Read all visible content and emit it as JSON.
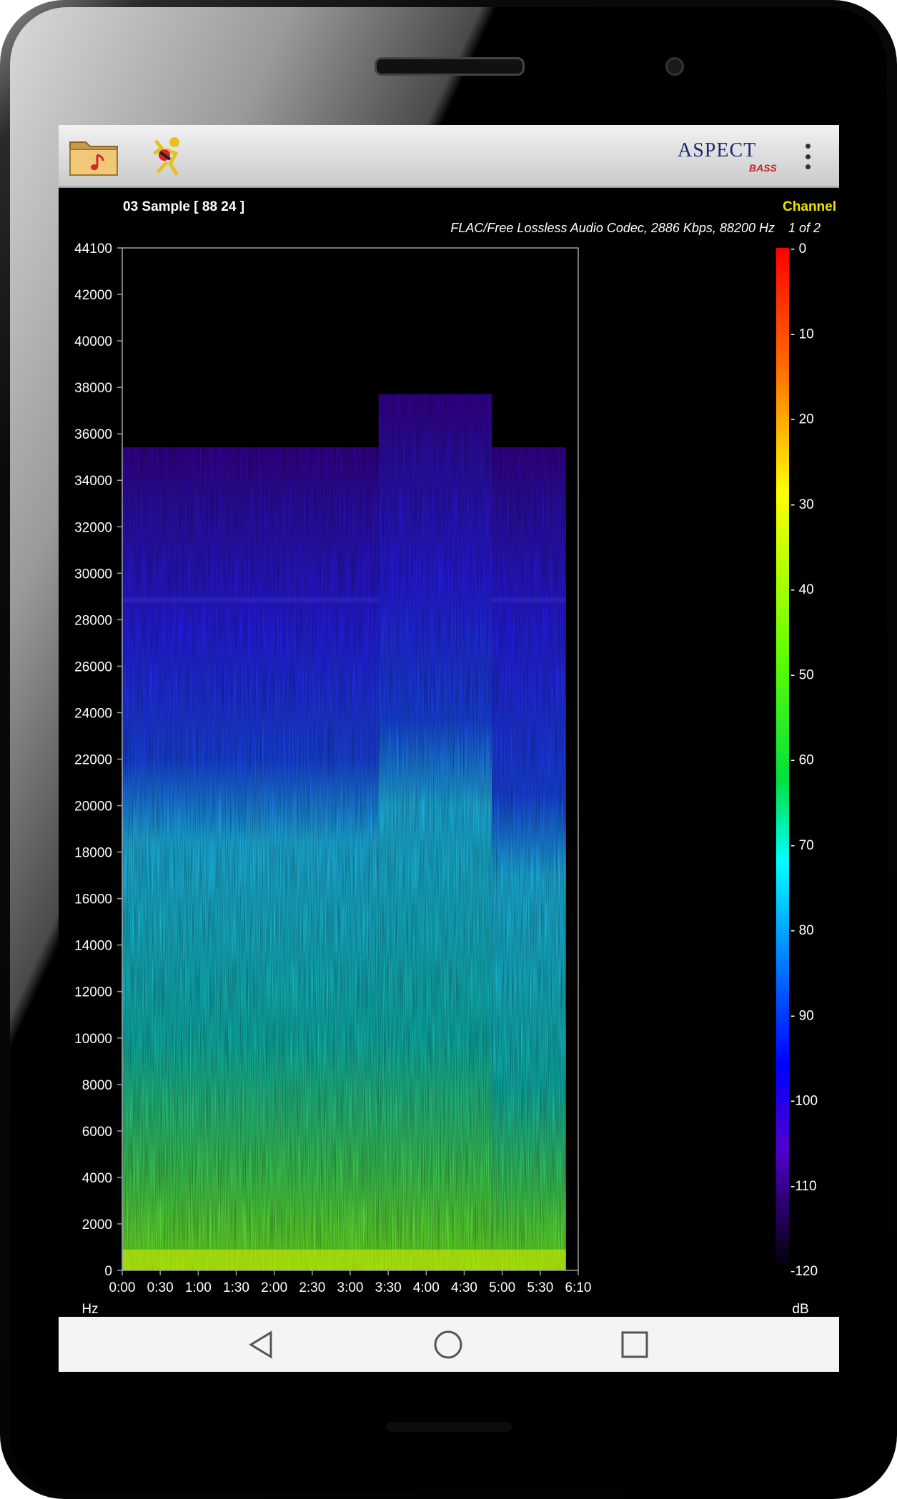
{
  "app": {
    "title_line": "03 Sample [ 88 24 ]",
    "codec_info": "FLAC/Free Lossless Audio Codec, 2886 Kbps, 88200 Hz",
    "channel_label": "Channel",
    "channel_value": "1 of 2",
    "logo_main": "ASPECT",
    "logo_sub": "BASS",
    "icons": {
      "open_file": "folder-music-icon",
      "tuner": "tuner-icon",
      "menu": "more-vert-icon",
      "back": "back-triangle-icon",
      "home": "home-circle-icon",
      "recents": "recents-square-icon"
    }
  },
  "chart_data": {
    "type": "heatmap",
    "xlabel": "",
    "ylabel": "Hz",
    "colorbar_label": "dB",
    "x_ticks": [
      "0:00",
      "0:30",
      "1:00",
      "1:30",
      "2:00",
      "2:30",
      "3:00",
      "3:30",
      "4:00",
      "4:30",
      "5:00",
      "5:30",
      "6:10"
    ],
    "y_ticks": [
      "44100",
      "42000",
      "40000",
      "38000",
      "36000",
      "34000",
      "32000",
      "30000",
      "28000",
      "26000",
      "24000",
      "22000",
      "20000",
      "18000",
      "16000",
      "14000",
      "12000",
      "10000",
      "8000",
      "6000",
      "4000",
      "2000",
      "0"
    ],
    "xlim_seconds": [
      0,
      370
    ],
    "ylim_hz": [
      0,
      44100
    ],
    "colorbar_ticks": [
      "- 0",
      "- 10",
      "- 20",
      "- 30",
      "- 40",
      "- 50",
      "- 60",
      "- 70",
      "- 80",
      "- 90",
      "-100",
      "-110",
      "-120"
    ],
    "colorbar_range_db": [
      -120,
      0
    ],
    "colors": {
      "colorbar_stops": [
        "#ff0000",
        "#ff8000",
        "#ffff00",
        "#00ff00",
        "#00ffff",
        "#0000ff",
        "#4000c0",
        "#000000"
      ],
      "spectrum_high": "#7cff20",
      "spectrum_mid": "#20c8ff",
      "spectrum_low": "#2a20ff",
      "spectrum_faint": "#3a00a0"
    },
    "segments": [
      {
        "start_s": 0,
        "end_s": 208,
        "cutoff_hz": 35500,
        "line_hz": 28900,
        "green_to_hz": 10000,
        "cyan_to_hz": 18500
      },
      {
        "start_s": 208,
        "end_s": 300,
        "cutoff_hz": 37800,
        "line_hz": null,
        "green_to_hz": 10000,
        "cyan_to_hz": 20000
      },
      {
        "start_s": 300,
        "end_s": 360,
        "cutoff_hz": 35500,
        "line_hz": 28900,
        "green_to_hz": 8000,
        "cyan_to_hz": 17000
      }
    ]
  }
}
